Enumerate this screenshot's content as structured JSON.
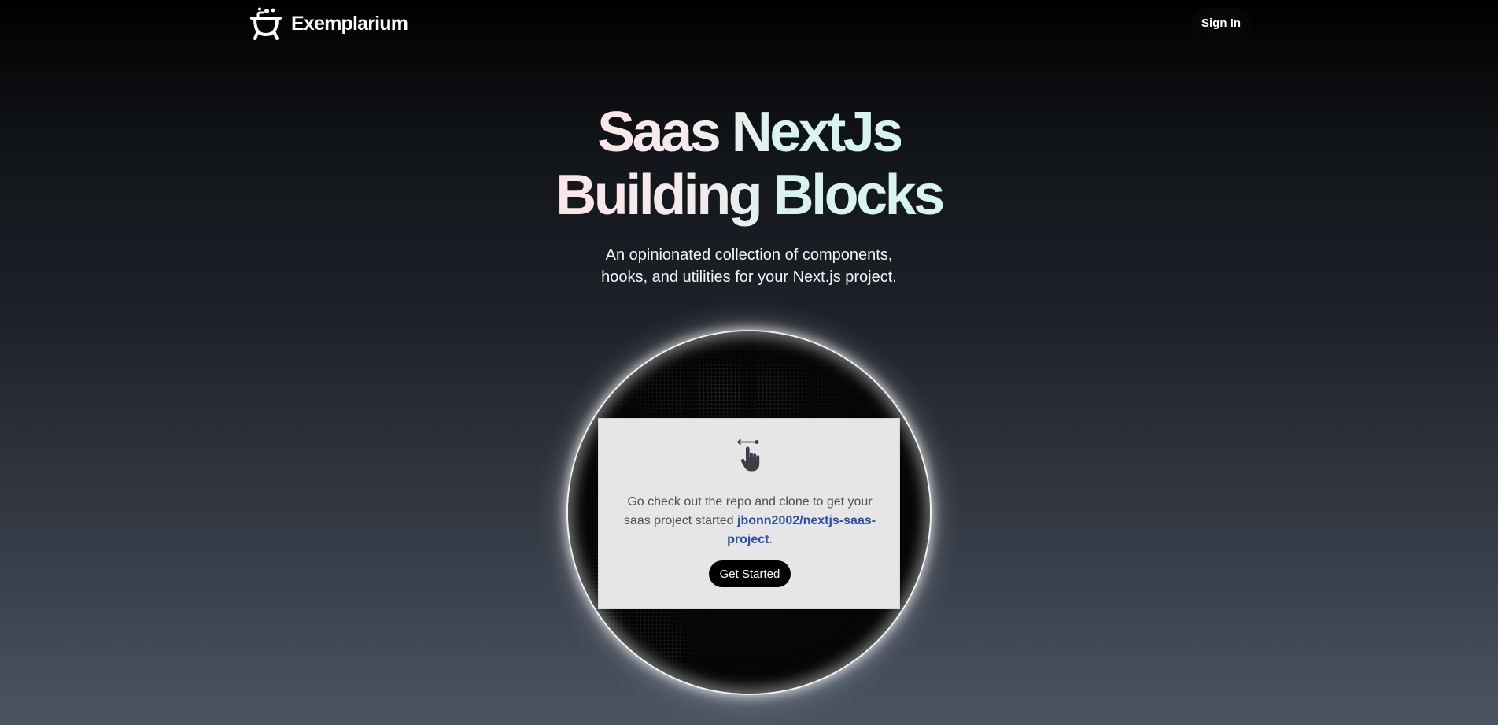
{
  "nav": {
    "brand_name": "Exemplarium",
    "brand_icon": "bathtub-icon",
    "signin_label": "Sign In"
  },
  "hero": {
    "title_line1": "Saas NextJs",
    "title_line2": "Building Blocks",
    "subtitle_line1": "An opinionated collection of components,",
    "subtitle_line2": "hooks, and utilities for your Next.js project."
  },
  "card": {
    "icon": "swipe-left-hand-icon",
    "text_before_link": "Go check out the repo and clone to get your saas project started ",
    "link_text": "jbonn2002/nextjs-saas-project",
    "text_after_link": ".",
    "cta_label": "Get Started"
  },
  "colors": {
    "card_background": "#e6e6e6",
    "link": "#2f4ba8",
    "button_background": "#000000",
    "title_gradient_start": "#fde5ea",
    "title_gradient_end": "#d6f5ef"
  }
}
